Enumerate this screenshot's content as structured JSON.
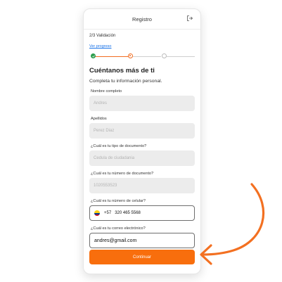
{
  "header": {
    "title": "Registro",
    "logout_icon": "logout-icon"
  },
  "progress": {
    "step_text": "2/3 Validación",
    "link_label": "Ver progreso",
    "completed_steps": 1,
    "current_step": 2,
    "total_steps": 3
  },
  "main": {
    "title": "Cuéntanos más de ti",
    "subtitle": "Completa tu información personal."
  },
  "form": {
    "nombre": {
      "label": "Nombre completo",
      "placeholder": "Andres"
    },
    "apellidos": {
      "label": "Apellidos",
      "placeholder": "Perez Diaz"
    },
    "tipo_documento": {
      "label": "¿Cuál es tu tipo de documento?",
      "placeholder": "Cedula de ciudadania"
    },
    "numero_documento": {
      "label": "¿Cuál es tu número de documento?",
      "placeholder": "1020553523"
    },
    "celular": {
      "label": "¿Cuál es tu número de celular?",
      "prefix": "+57",
      "value": "320 465 5568",
      "flag_icon": "colombia-flag-icon"
    },
    "correo": {
      "label": "¿Cuál es tu correo electrónico?",
      "value": "andres@gmail.com"
    }
  },
  "actions": {
    "continue_label": "Continuar"
  },
  "colors": {
    "accent": "#f86e0d",
    "success": "#2e9e4f",
    "link": "#1a73e8",
    "field_bg": "#ececec"
  }
}
